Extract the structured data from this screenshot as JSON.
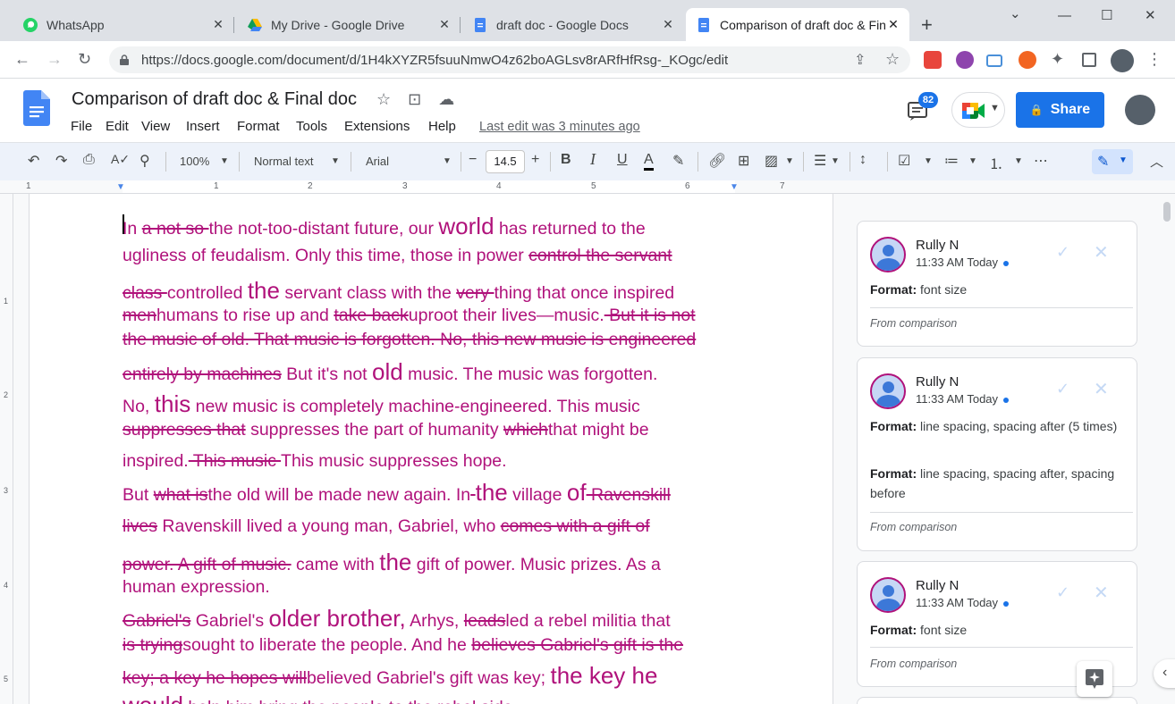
{
  "browser": {
    "tabs": [
      {
        "title": "WhatsApp",
        "icon": "whatsapp-icon",
        "active": false
      },
      {
        "title": "My Drive - Google Drive",
        "icon": "google-drive-icon",
        "active": false
      },
      {
        "title": "draft doc - Google Docs",
        "icon": "google-docs-icon",
        "active": false
      },
      {
        "title": "Comparison of draft doc & Final doc",
        "display": "Comparison of draft doc & Fina",
        "icon": "google-docs-icon",
        "active": true
      }
    ],
    "close_glyph": "✕",
    "new_tab_glyph": "+",
    "url": "https://docs.google.com/document/d/1H4kXYZR5fsuuNmwO4z62boAGLsv8rARfHfRsg-_KOgc/edit"
  },
  "docs": {
    "title": "Comparison of draft doc & Final doc",
    "menus": [
      "File",
      "Edit",
      "View",
      "Insert",
      "Format",
      "Tools",
      "Extensions",
      "Help"
    ],
    "last_edit": "Last edit was 3 minutes ago",
    "comment_count": "82",
    "share_label": "Share",
    "lock_glyph": "🔒"
  },
  "toolbar": {
    "zoom": "100%",
    "style": "Normal text",
    "font": "Arial",
    "font_size": "14.5",
    "minus": "−",
    "plus": "+",
    "bold": "B",
    "italic": "I",
    "underline": "U",
    "text_color": "A"
  },
  "ruler": {
    "labels": [
      "1",
      "1",
      "2",
      "3",
      "4",
      "5",
      "6",
      "7"
    ],
    "vlabels": [
      "1",
      "2",
      "3",
      "4",
      "5"
    ]
  },
  "document": {
    "lines": [
      [
        {
          "t": "In "
        },
        {
          "t": "a not so ",
          "d": true
        },
        {
          "t": "the not-too-distant future, our "
        },
        {
          "t": "world",
          "b": true
        },
        {
          "t": " has returned to the"
        }
      ],
      [
        {
          "t": "ugliness of feudalism. Only this time, those in power "
        },
        {
          "t": "control the servant",
          "d": true
        }
      ],
      [
        {
          "t": "class ",
          "d": true
        },
        {
          "t": "controlled "
        },
        {
          "t": "the",
          "b": true
        },
        {
          "t": "  servant class  with the "
        },
        {
          "t": "very ",
          "d": true
        },
        {
          "t": "thing that once inspired"
        }
      ],
      [
        {
          "t": "men",
          "d": true
        },
        {
          "t": "humans to rise up and "
        },
        {
          "t": "take back",
          "d": true
        },
        {
          "t": "uproot their lives—music."
        },
        {
          "t": " But it is not",
          "d": true
        }
      ],
      [
        {
          "t": "the music of old. That music is forgotten. No, this new music is engineered",
          "d": true
        }
      ],
      [
        {
          "t": "entirely by machines",
          "d": true
        },
        {
          "t": "  But it's not "
        },
        {
          "t": "old",
          "b": true
        },
        {
          "t": "  music.  The music was forgotten."
        }
      ],
      [
        {
          "t": "No,  "
        },
        {
          "t": "this",
          "b": true
        },
        {
          "t": "  new music is completely machine-engineered. This music"
        },
        {
          "t": " ",
          "d": true
        }
      ],
      [
        {
          "t": "suppresses that",
          "d": true
        },
        {
          "t": "  suppresses the part of humanity "
        },
        {
          "t": "which",
          "d": true
        },
        {
          "t": "that might be"
        }
      ],
      [
        {
          "t": "inspired."
        },
        {
          "t": " This music ",
          "d": true
        },
        {
          "t": "  This music  suppresses hope."
        }
      ],
      [
        {
          "t": "But "
        },
        {
          "t": "what is",
          "d": true
        },
        {
          "t": "the old will be made new again. In"
        },
        {
          "t": " ",
          "d": true
        },
        {
          "t": "  "
        },
        {
          "t": "the",
          "b": true
        },
        {
          "t": " village "
        },
        {
          "t": "of",
          "b": true
        },
        {
          "t": " Ravenskill",
          "d": true
        }
      ],
      [
        {
          "t": "lives",
          "d": true
        },
        {
          "t": "  Ravenskill lived a young man, Gabriel, who "
        },
        {
          "t": "comes with a gift of",
          "d": true
        }
      ],
      [
        {
          "t": "power. A gift of music.",
          "d": true
        },
        {
          "t": " came with "
        },
        {
          "t": "the",
          "b": true
        },
        {
          "t": "  gift of power.  Music prizes.  As a"
        }
      ],
      [
        {
          "t": "human expression."
        }
      ],
      [
        {
          "t": "Gabriel's",
          "d": true
        },
        {
          "t": " Gabriel's  "
        },
        {
          "t": "older brother,",
          "b": true
        },
        {
          "t": " Arhys, "
        },
        {
          "t": "leads",
          "d": true
        },
        {
          "t": "led a rebel militia that"
        }
      ],
      [
        {
          "t": "is trying",
          "d": true
        },
        {
          "t": "sought to liberate the people. And he "
        },
        {
          "t": "believes Gabriel's gift is the",
          "d": true
        }
      ],
      [
        {
          "t": "key; a key he hopes will",
          "d": true
        },
        {
          "t": "believed Gabriel's  gift was key;  "
        },
        {
          "t": "the key he",
          "b": true
        }
      ],
      [
        {
          "t": "          "
        },
        {
          "t": "would",
          "b": true
        },
        {
          "t": " help him bring the people to the rebel side."
        }
      ]
    ]
  },
  "suggestions": [
    {
      "author": "Rully N",
      "time": "11:33 AM Today",
      "items": [
        {
          "label": "Format:",
          "text": " font size"
        }
      ],
      "footer": "From comparison"
    },
    {
      "author": "Rully N",
      "time": "11:33 AM Today",
      "items": [
        {
          "label": "Format:",
          "text": " line spacing, spacing after (5 times)"
        },
        {
          "label": "Format:",
          "text": " line spacing, spacing after, spacing before"
        }
      ],
      "footer": "From comparison"
    },
    {
      "author": "Rully N",
      "time": "11:33 AM Today",
      "items": [
        {
          "label": "Format:",
          "text": " font size"
        }
      ],
      "footer": "From comparison"
    }
  ],
  "colors": {
    "suggestion": "#b0127b",
    "accent": "#1a73e8"
  }
}
